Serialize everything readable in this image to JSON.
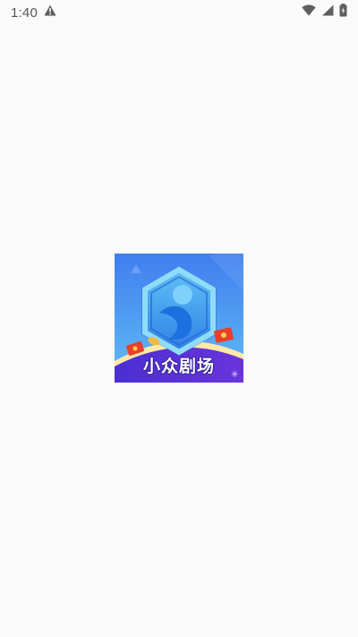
{
  "status_bar": {
    "time": "1:40",
    "icons": [
      "alert-triangle-icon",
      "wifi-icon",
      "cell-signal-icon",
      "battery-icon"
    ]
  },
  "splash": {
    "app_name": "小众剧场",
    "colors": {
      "background": "#fafafa",
      "logo_sky_top": "#3f7ef0",
      "logo_sky_bottom": "#5fb6f2",
      "logo_banner": "#5a2bd6",
      "logo_hex_frame": "#7fd4f7",
      "logo_mascot": "#1e88e5"
    }
  }
}
